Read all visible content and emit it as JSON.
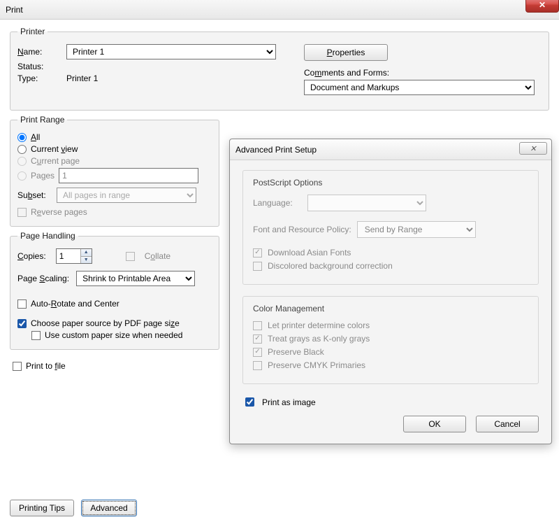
{
  "window": {
    "title": "Print",
    "close": "✕"
  },
  "printer": {
    "legend": "Printer",
    "name_label": "Name:",
    "name_value": "Printer 1",
    "status_label": "Status:",
    "status_value": "",
    "type_label": "Type:",
    "type_value": "Printer 1",
    "properties_btn": "Properties",
    "comments_label": "Comments and Forms:",
    "comments_value": "Document and Markups"
  },
  "range": {
    "legend": "Print Range",
    "all": "All",
    "current_view": "Current view",
    "current_page": "Current page",
    "pages": "Pages",
    "pages_value": "1",
    "subset_label": "Subset:",
    "subset_value": "All pages in range",
    "reverse": "Reverse pages"
  },
  "handling": {
    "legend": "Page Handling",
    "copies_label": "Copies:",
    "copies_value": "1",
    "collate": "Collate",
    "scaling_label": "Page Scaling:",
    "scaling_value": "Shrink to Printable Area",
    "auto_rotate": "Auto-Rotate and Center",
    "choose_paper": "Choose paper source by PDF page size",
    "custom_paper": "Use custom paper size when needed"
  },
  "misc": {
    "print_to_file": "Print to file"
  },
  "footer": {
    "printing_tips": "Printing Tips",
    "advanced": "Advanced"
  },
  "adv": {
    "title": "Advanced Print Setup",
    "close": "✕",
    "ps_legend": "PostScript Options",
    "language_label": "Language:",
    "language_value": "",
    "font_policy_label": "Font and Resource Policy:",
    "font_policy_value": "Send by Range",
    "download_asian": "Download Asian Fonts",
    "discolored": "Discolored background correction",
    "cm_legend": "Color Management",
    "let_printer": "Let printer determine colors",
    "treat_grays": "Treat grays as K-only grays",
    "preserve_black": "Preserve Black",
    "preserve_cmyk": "Preserve CMYK Primaries",
    "print_as_image": "Print as image",
    "ok": "OK",
    "cancel": "Cancel"
  }
}
